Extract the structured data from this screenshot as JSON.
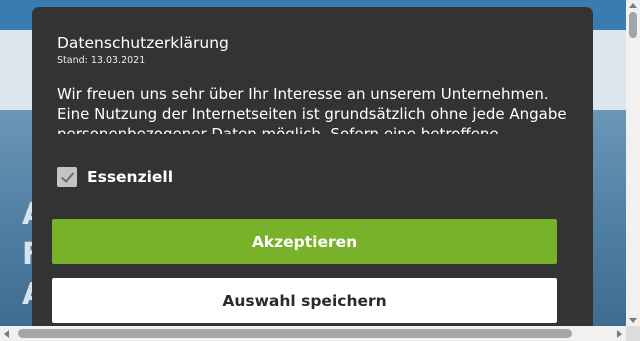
{
  "dialog": {
    "title": "Datenschutzerklärung",
    "date": "Stand: 13.03.2021",
    "text": "Wir freuen uns sehr über Ihr Interesse an unserem Unternehmen. Eine Nutzung der Internetseiten ist grundsätzlich ohne jede Angabe personenbezogener Daten möglich. Sofern eine betroffene",
    "checkbox_label": "Essenziell",
    "checkbox_checked": true,
    "accept_label": "Akzeptieren",
    "save_label": "Auswahl speichern"
  },
  "background": {
    "hero_letters": [
      "A",
      "F",
      "A"
    ]
  },
  "colors": {
    "dialog_bg": "#333333",
    "accept_bg": "#77b22a",
    "topbar": "#3b7cb0"
  }
}
